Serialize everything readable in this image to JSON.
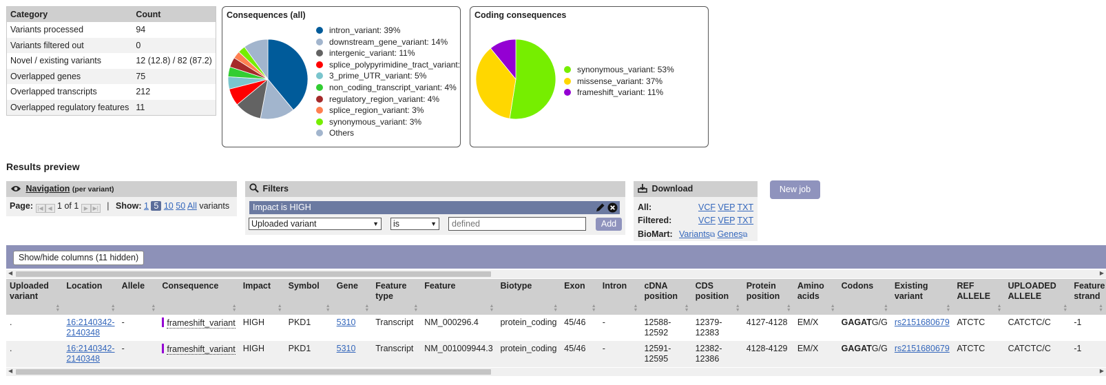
{
  "stats": {
    "headers": [
      "Category",
      "Count"
    ],
    "rows": [
      [
        "Variants processed",
        "94"
      ],
      [
        "Variants filtered out",
        "0"
      ],
      [
        "Novel / existing variants",
        "12 (12.8) / 82 (87.2)"
      ],
      [
        "Overlapped genes",
        "75"
      ],
      [
        "Overlapped transcripts",
        "212"
      ],
      [
        "Overlapped regulatory features",
        "11"
      ]
    ]
  },
  "pie_all": {
    "title": "Consequences (all)",
    "legend": [
      {
        "label": "intron_variant: 39%",
        "color": "#005b9a"
      },
      {
        "label": "downstream_gene_variant: 14%",
        "color": "#a2b5cd"
      },
      {
        "label": "intergenic_variant: 11%",
        "color": "#636363"
      },
      {
        "label": "splice_polypyrimidine_tract_variant:",
        "color": "#ff0000"
      },
      {
        "label": "3_prime_UTR_variant: 5%",
        "color": "#7ac5cd"
      },
      {
        "label": "non_coding_transcript_variant: 4%",
        "color": "#32cd32"
      },
      {
        "label": "regulatory_region_variant: 4%",
        "color": "#a52a2a"
      },
      {
        "label": "splice_region_variant: 3%",
        "color": "#ff7f50"
      },
      {
        "label": "synonymous_variant: 3%",
        "color": "#76ee00"
      },
      {
        "label": "Others",
        "color": "#a2b5cd"
      }
    ]
  },
  "pie_coding": {
    "title": "Coding consequences",
    "legend": [
      {
        "label": "synonymous_variant: 53%",
        "color": "#76ee00"
      },
      {
        "label": "missense_variant: 37%",
        "color": "#ffd700"
      },
      {
        "label": "frameshift_variant: 11%",
        "color": "#9400d3"
      }
    ]
  },
  "chart_data": [
    {
      "type": "pie",
      "title": "Consequences (all)",
      "categories": [
        "intron_variant",
        "downstream_gene_variant",
        "intergenic_variant",
        "splice_polypyrimidine_tract_variant",
        "3_prime_UTR_variant",
        "non_coding_transcript_variant",
        "regulatory_region_variant",
        "splice_region_variant",
        "synonymous_variant",
        "Others"
      ],
      "values": [
        39,
        14,
        11,
        7,
        5,
        4,
        4,
        3,
        3,
        10
      ],
      "colors": [
        "#005b9a",
        "#a2b5cd",
        "#636363",
        "#ff0000",
        "#7ac5cd",
        "#32cd32",
        "#a52a2a",
        "#ff7f50",
        "#76ee00",
        "#a2b5cd"
      ],
      "legend": "right"
    },
    {
      "type": "pie",
      "title": "Coding consequences",
      "categories": [
        "synonymous_variant",
        "missense_variant",
        "frameshift_variant"
      ],
      "values": [
        53,
        37,
        11
      ],
      "colors": [
        "#76ee00",
        "#ffd700",
        "#9400d3"
      ],
      "legend": "right"
    }
  ],
  "results_title": "Results preview",
  "navigation": {
    "title": "Navigation",
    "subtitle": "(per variant)",
    "page_label": "Page:",
    "page_text": "1 of 1",
    "show_label": "Show:",
    "show_options": [
      "1",
      "5",
      "10",
      "50",
      "All"
    ],
    "show_selected": "5",
    "show_suffix": "variants"
  },
  "filters": {
    "title": "Filters",
    "active": "Impact is HIGH",
    "field_select": "Uploaded variant",
    "op_select": "is",
    "value_placeholder": "defined",
    "add_label": "Add"
  },
  "download": {
    "title": "Download",
    "rows": [
      {
        "label": "All:",
        "links": [
          "VCF",
          "VEP",
          "TXT"
        ]
      },
      {
        "label": "Filtered:",
        "links": [
          "VCF",
          "VEP",
          "TXT"
        ]
      },
      {
        "label": "BioMart:",
        "links": [
          "Variants",
          "Genes"
        ]
      }
    ]
  },
  "new_job": "New job",
  "columns_button": "Show/hide columns (11 hidden)",
  "table": {
    "headers": [
      [
        "Uploaded",
        "variant"
      ],
      [
        "Location",
        ""
      ],
      [
        "Allele",
        ""
      ],
      [
        "Consequence",
        ""
      ],
      [
        "Impact",
        ""
      ],
      [
        "Symbol",
        ""
      ],
      [
        "Gene",
        ""
      ],
      [
        "Feature",
        "type"
      ],
      [
        "Feature",
        ""
      ],
      [
        "Biotype",
        ""
      ],
      [
        "Exon",
        ""
      ],
      [
        "Intron",
        ""
      ],
      [
        "cDNA",
        "position"
      ],
      [
        "CDS",
        "position"
      ],
      [
        "Protein",
        "position"
      ],
      [
        "Amino",
        "acids"
      ],
      [
        "Codons",
        ""
      ],
      [
        "Existing",
        "variant"
      ],
      [
        "REF",
        "ALLELE"
      ],
      [
        "UPLOADED",
        "ALLELE"
      ],
      [
        "Feature",
        "strand"
      ]
    ],
    "rows": [
      {
        "uploaded": ".",
        "location": "16:2140342-2140348",
        "allele": "-",
        "consequence": "frameshift_variant",
        "impact": "HIGH",
        "symbol": "PKD1",
        "gene": "5310",
        "feature_type": "Transcript",
        "feature": "NM_000296.4",
        "biotype": "protein_coding",
        "exon": "45/46",
        "intron": "-",
        "cdna": "12588-12592",
        "cds": "12379-12383",
        "protein": "4127-4128",
        "amino": "EM/X",
        "codons_bold": "GAGAT",
        "codons_rest": "G/G",
        "existing": "rs2151680679",
        "ref": "ATCTC",
        "uploaded_allele": "CATCTC/C",
        "strand": "-1"
      },
      {
        "uploaded": ".",
        "location": "16:2140342-2140348",
        "allele": "-",
        "consequence": "frameshift_variant",
        "impact": "HIGH",
        "symbol": "PKD1",
        "gene": "5310",
        "feature_type": "Transcript",
        "feature": "NM_001009944.3",
        "biotype": "protein_coding",
        "exon": "45/46",
        "intron": "-",
        "cdna": "12591-12595",
        "cds": "12382-12386",
        "protein": "4128-4129",
        "amino": "EM/X",
        "codons_bold": "GAGAT",
        "codons_rest": "G/G",
        "existing": "rs2151680679",
        "ref": "ATCTC",
        "uploaded_allele": "CATCTC/C",
        "strand": "-1"
      }
    ]
  }
}
